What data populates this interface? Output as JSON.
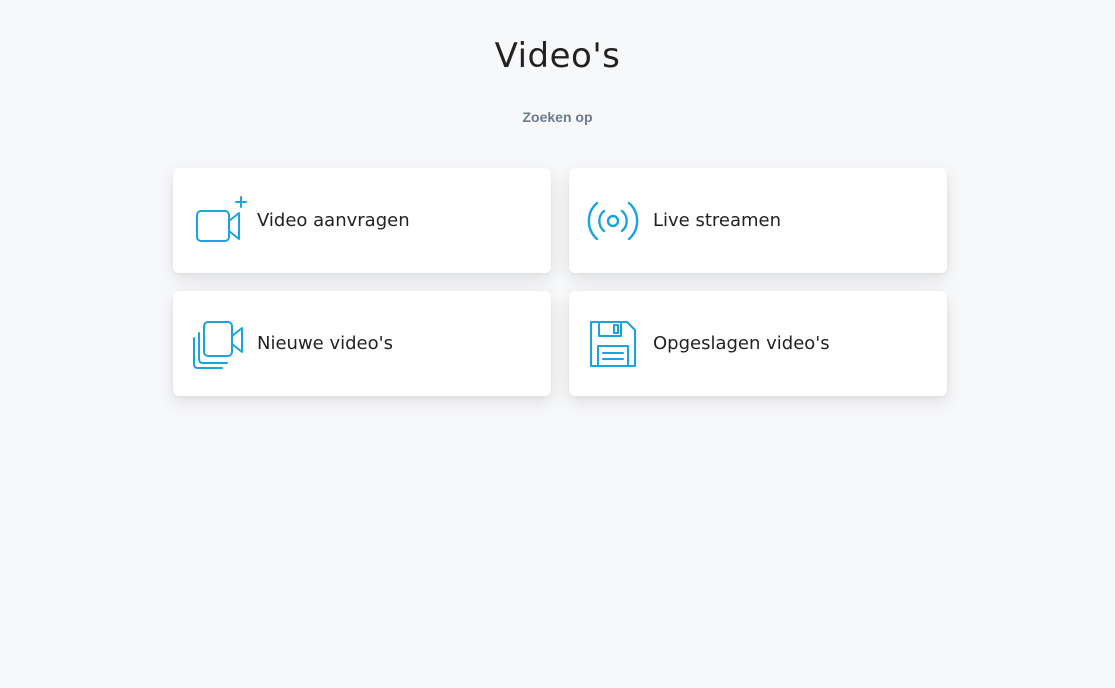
{
  "page": {
    "title": "Video's",
    "search_link": "Zoeken op"
  },
  "colors": {
    "accent": "#1aa3dc",
    "background": "#f7f8fa",
    "text": "#222222",
    "muted": "#6b7c8c"
  },
  "cards": [
    {
      "label": "Video aanvragen",
      "icon": "video-camera-plus-icon"
    },
    {
      "label": "Live streamen",
      "icon": "broadcast-icon"
    },
    {
      "label": "Nieuwe video's",
      "icon": "stacked-video-camera-icon"
    },
    {
      "label": "Opgeslagen video's",
      "icon": "floppy-disk-icon"
    }
  ]
}
